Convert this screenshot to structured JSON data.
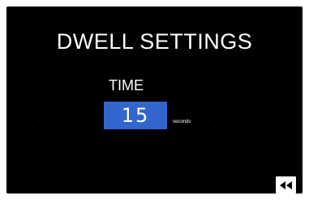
{
  "screen": {
    "title": "DWELL SETTINGS",
    "field_label": "TIME",
    "value": "15",
    "unit": "seconds",
    "back_icon": "rewind-icon"
  },
  "colors": {
    "background": "#000000",
    "value_box": "#3366cc",
    "text": "#ffffff",
    "button": "#ffffff",
    "button_icon": "#000000"
  }
}
